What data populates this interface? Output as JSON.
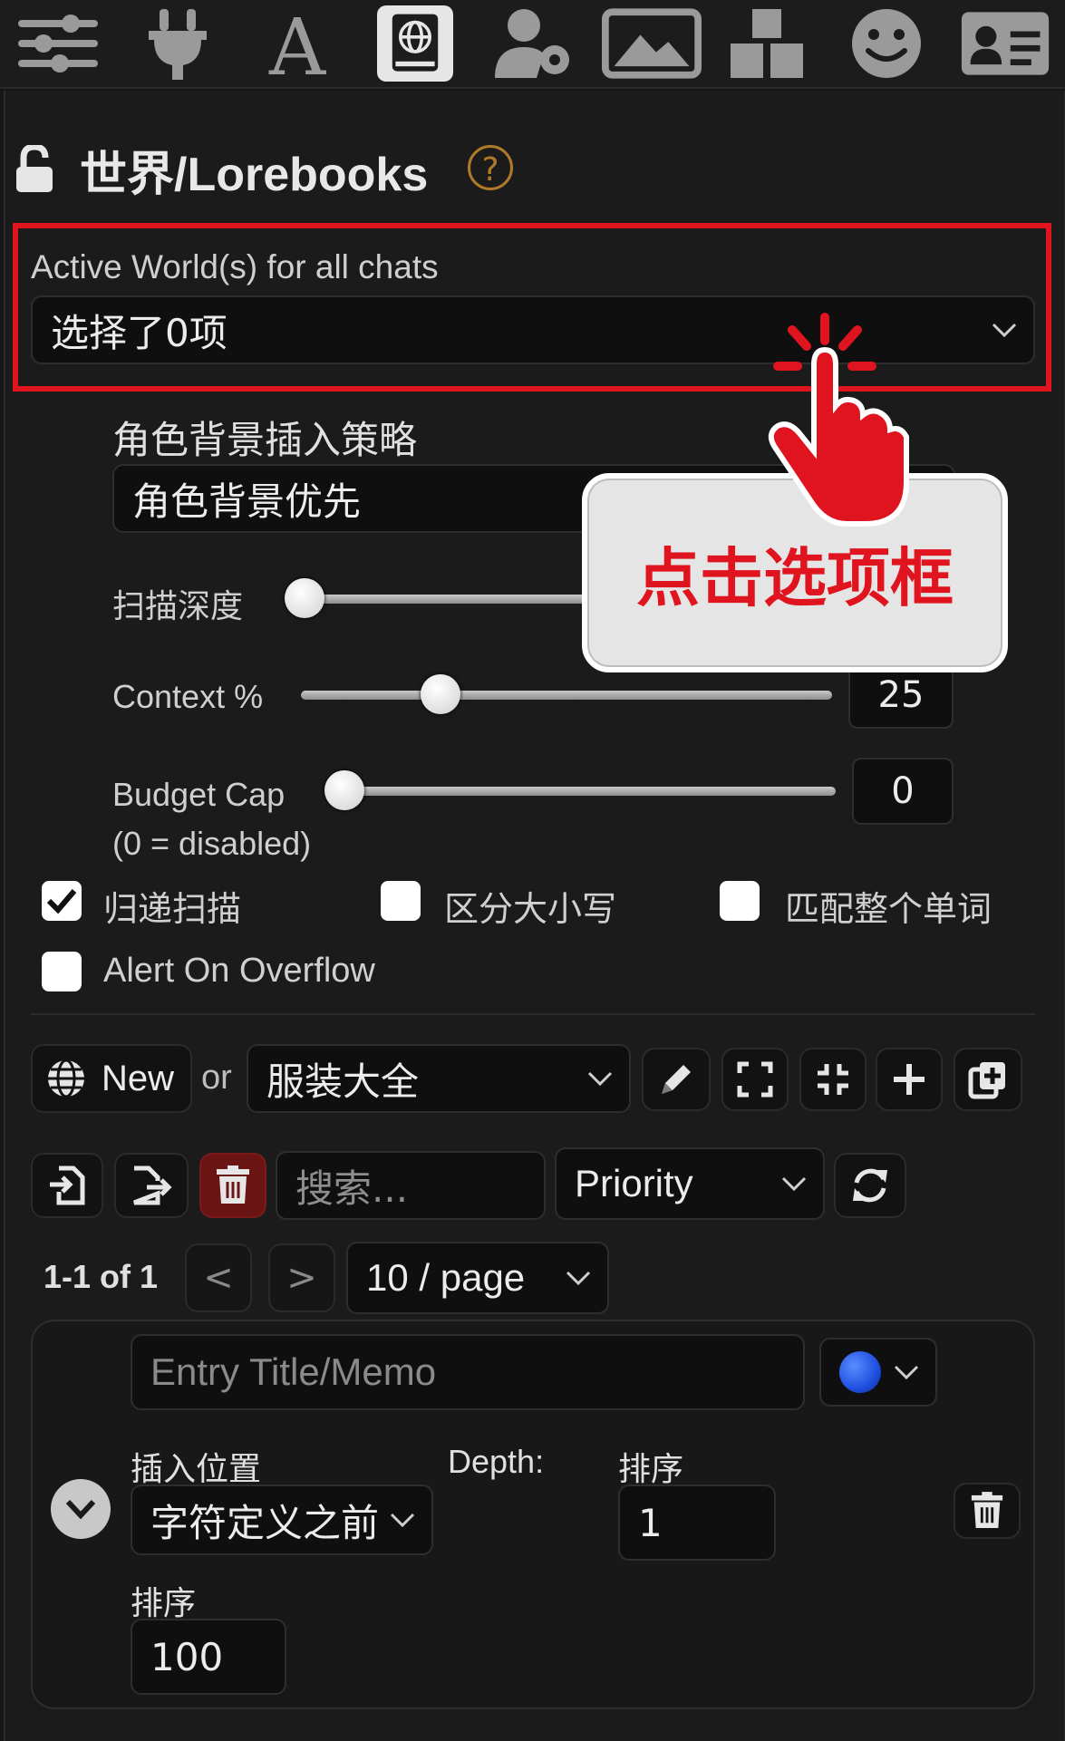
{
  "topbar": {
    "icons": [
      "sliders-icon",
      "plug-icon",
      "font-icon",
      "globe-book-icon",
      "user-gear-icon",
      "image-icon",
      "cubes-icon",
      "smiley-icon",
      "id-card-icon"
    ],
    "active_index": 3
  },
  "header": {
    "title": "世界/Lorebooks",
    "help": "?"
  },
  "active_worlds": {
    "label": "Active World(s) for all chats",
    "value": "选择了0项"
  },
  "insertion_strategy": {
    "label": "角色背景插入策略",
    "value": "角色背景优先"
  },
  "scan_depth": {
    "label": "扫描深度",
    "level": 0.05
  },
  "context": {
    "label": "Context %",
    "value": "25",
    "level": 0.26
  },
  "budget_cap": {
    "label": "Budget Cap",
    "sublabel": "(0 = disabled)",
    "value": "0",
    "level": 0.0
  },
  "checkboxes": {
    "recursive": {
      "label": "归递扫描",
      "checked": true
    },
    "case_sensitive": {
      "label": "区分大小写",
      "checked": false
    },
    "match_whole": {
      "label": "匹配整个单词",
      "checked": false
    },
    "alert_overflow": {
      "label": "Alert On Overflow",
      "checked": false
    }
  },
  "world_row": {
    "new_label": "New",
    "or_label": "or",
    "selected_world": "服装大全"
  },
  "toolbar": {
    "search_placeholder": "搜索...",
    "sort_value": "Priority"
  },
  "pagination": {
    "range": "1-1 of 1",
    "prev": "<",
    "next": ">",
    "page_size": "10 / page"
  },
  "entry": {
    "title_placeholder": "Entry Title/Memo",
    "position_label": "插入位置",
    "position_value": "字符定义之前",
    "depth_label": "Depth:",
    "order_label_top": "排序",
    "order_value_top": "1",
    "order_label": "排序",
    "order_value": "100",
    "status_color": "#1f4fe0"
  },
  "overlay": {
    "text": "点击选项框"
  },
  "colors": {
    "accent_red": "#e0141e",
    "help_orange": "#b07a2a"
  }
}
